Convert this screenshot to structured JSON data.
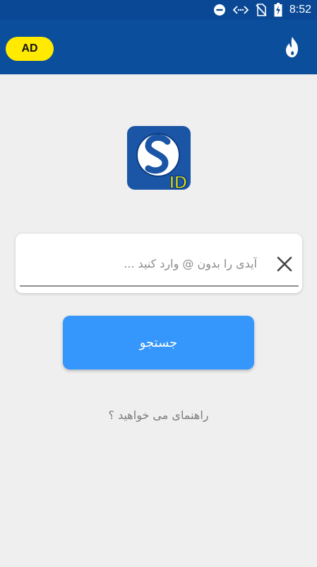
{
  "status_bar": {
    "time": "8:52",
    "icons": [
      "do-not-disturb-icon",
      "data-transfer-icon",
      "no-sim-icon",
      "battery-charging-icon"
    ]
  },
  "app_bar": {
    "ad_label": "AD",
    "flame_icon": "flame-icon",
    "background": "#0b4f9c"
  },
  "logo": {
    "badge_text": "ID"
  },
  "search": {
    "placeholder": "آیدی را بدون @ وارد کنید ...",
    "value": "",
    "clear_icon": "close-icon"
  },
  "search_button": {
    "label": "جستجو",
    "color": "#3596fb"
  },
  "help": {
    "label": "راهنمای می خواهید ؟"
  },
  "colors": {
    "accent": "#3596fb",
    "ad_yellow": "#ffea00",
    "logo_yellow": "#f2e600"
  }
}
